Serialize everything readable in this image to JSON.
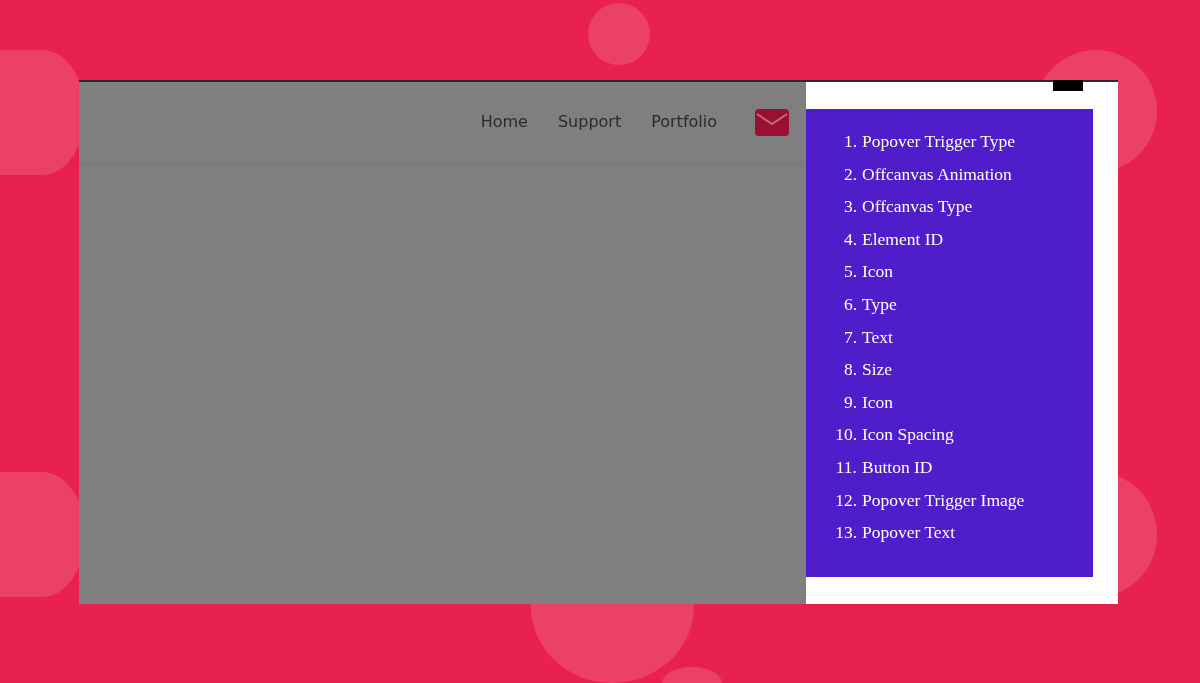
{
  "nav": {
    "links": [
      {
        "label": "Home"
      },
      {
        "label": "Support"
      },
      {
        "label": "Portfolio"
      }
    ]
  },
  "offcanvas": {
    "items": [
      {
        "number": "1.",
        "label": "Popover Trigger Type"
      },
      {
        "number": "2.",
        "label": "Offcanvas Animation"
      },
      {
        "number": "3.",
        "label": "Offcanvas Type"
      },
      {
        "number": "4.",
        "label": "Element ID"
      },
      {
        "number": "5.",
        "label": "Icon"
      },
      {
        "number": "6.",
        "label": "Type"
      },
      {
        "number": "7.",
        "label": "Text"
      },
      {
        "number": "8.",
        "label": "Size"
      },
      {
        "number": "9.",
        "label": "Icon"
      },
      {
        "number": "10.",
        "label": "Icon Spacing"
      },
      {
        "number": "11.",
        "label": "Button ID"
      },
      {
        "number": "12.",
        "label": "Popover Trigger Image"
      },
      {
        "number": "13.",
        "label": "Popover Text"
      }
    ]
  }
}
